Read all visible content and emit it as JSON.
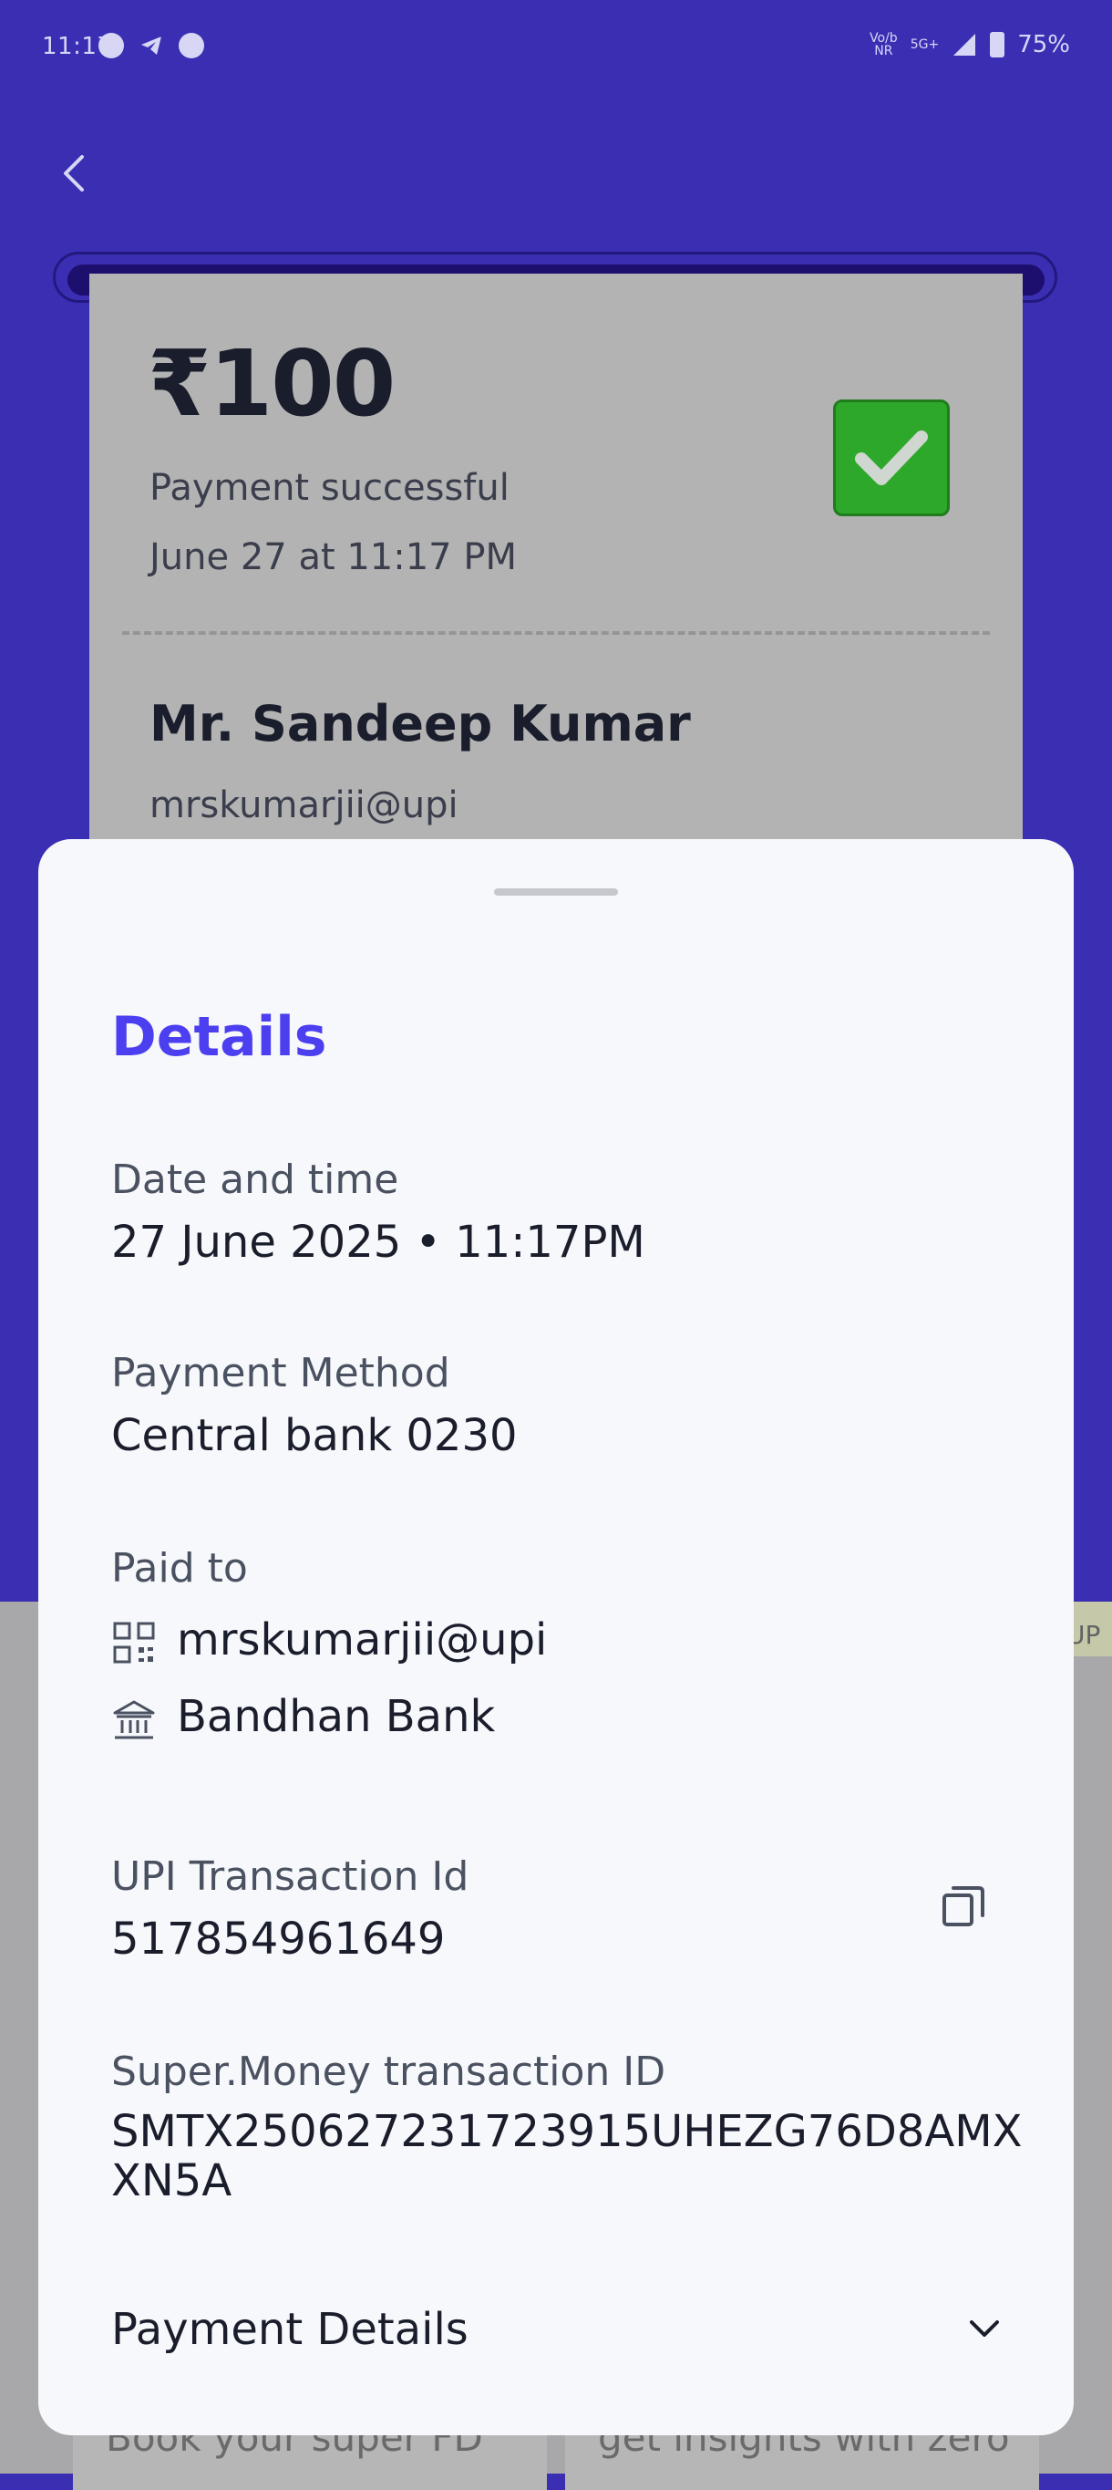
{
  "status_bar": {
    "time": "11:17",
    "network_label_top": "Vo/b",
    "network_label_bottom": "NR",
    "network_type": "5G+",
    "battery": "75%"
  },
  "receipt": {
    "amount": "₹100",
    "status": "Payment successful",
    "datetime": "June 27 at 11:17 PM",
    "payee_name": "Mr. Sandeep Kumar",
    "payee_upi": "mrskumarjii@upi"
  },
  "details": {
    "title": "Details",
    "date_label": "Date and time",
    "date_value": "27 June 2025 • 11:17PM",
    "method_label": "Payment Method",
    "method_value": "Central bank 0230",
    "paid_to_label": "Paid to",
    "paid_to_upi": "mrskumarjii@upi",
    "paid_to_bank": "Bandhan Bank",
    "upi_txn_label": "UPI Transaction Id",
    "upi_txn_value": "517854961649",
    "sm_txn_label": "Super.Money transaction ID",
    "sm_txn_value": "SMTX250627231723915UHEZG76D8AMXXN5A",
    "payment_details_label": "Payment Details"
  },
  "background": {
    "side_chip": "UP",
    "promo_left": "Book your super FD",
    "promo_right": "get insights with zero"
  },
  "colors": {
    "header_bg": "#3a2fb3",
    "accent": "#4c3ff0",
    "success": "#2ea82b"
  }
}
